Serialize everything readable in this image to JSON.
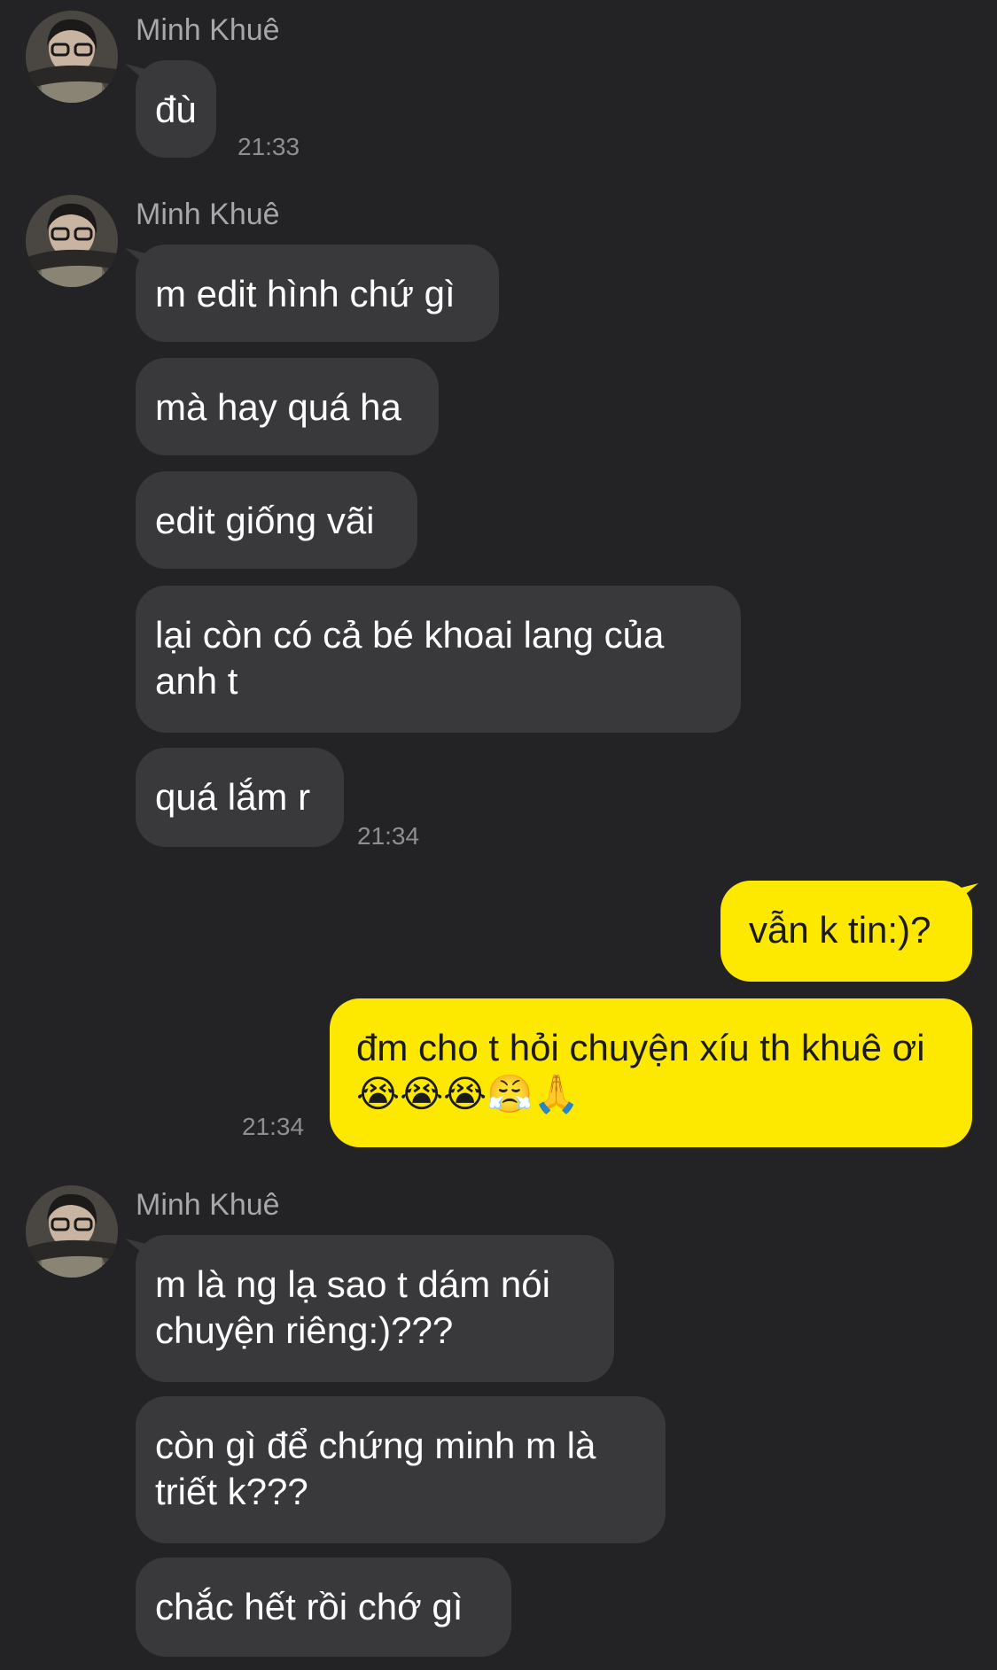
{
  "contact": {
    "name": "Minh Khuê"
  },
  "groups": [
    {
      "sender": "Minh Khuê",
      "messages": [
        "đù"
      ],
      "time": "21:33"
    },
    {
      "sender": "Minh Khuê",
      "messages": [
        "m edit hình chứ gì",
        "mà hay quá ha",
        "edit giống vãi",
        "lại còn có cả bé khoai lang của anh t",
        "quá lắm r"
      ],
      "time": "21:34"
    },
    {
      "sender": "me",
      "messages": [
        "vẫn k tin:)?",
        "đm cho t hỏi chuyện xíu th khuê ơi😭😭😭😤🙏"
      ],
      "time": "21:34"
    },
    {
      "sender": "Minh Khuê",
      "messages": [
        "m là ng lạ sao t dám nói chuyện riêng:)???",
        "còn gì để chứng minh m là triết k???",
        "chắc hết rồi chớ gì"
      ]
    }
  ]
}
